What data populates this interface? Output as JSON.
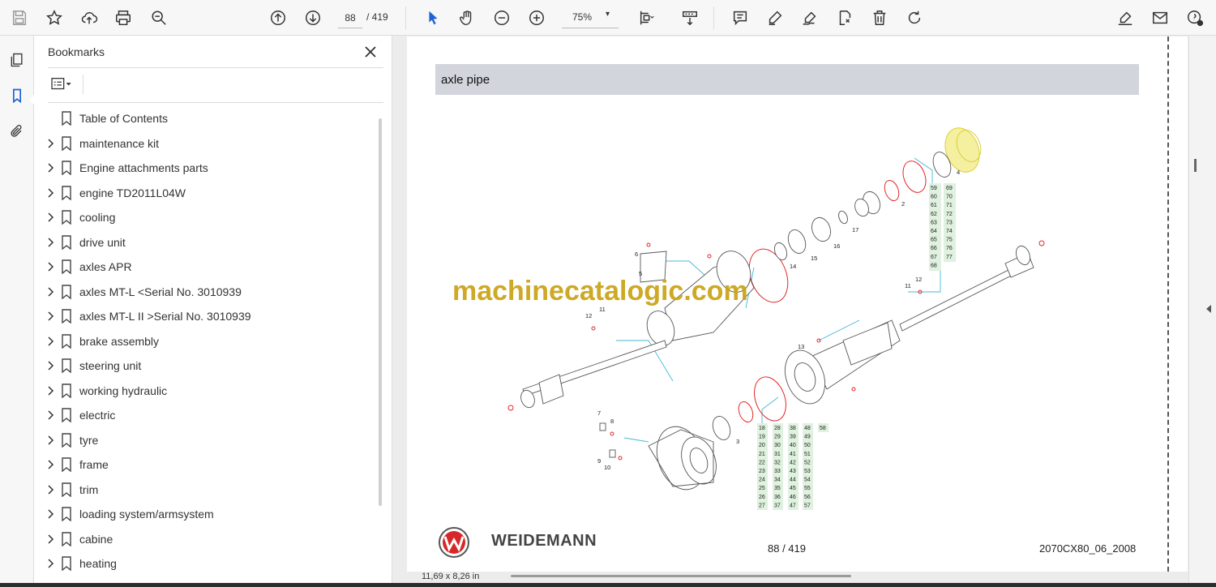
{
  "toolbar": {
    "page_current": "88",
    "page_total": "/ 419",
    "zoom": "75%",
    "icons": [
      "save-icon",
      "star-icon",
      "upload-cloud-icon",
      "print-icon",
      "zoom-search-icon",
      "page-up-icon",
      "page-down-icon",
      "select-cursor-icon",
      "hand-pan-icon",
      "zoom-out-icon",
      "zoom-in-icon",
      "fit-page-icon",
      "scroll-mode-icon",
      "comment-icon",
      "highlight-pen-icon",
      "draw-icon",
      "stamp-icon",
      "delete-icon",
      "rotate-icon",
      "sign-icon",
      "mail-icon",
      "account-icon"
    ]
  },
  "panel": {
    "title": "Bookmarks",
    "bookmarks": [
      {
        "label": "Table of Contents",
        "expandable": false
      },
      {
        "label": "maintenance kit",
        "expandable": true
      },
      {
        "label": "Engine attachments parts",
        "expandable": true
      },
      {
        "label": "engine TD2011L04W",
        "expandable": true
      },
      {
        "label": "cooling",
        "expandable": true
      },
      {
        "label": "drive unit",
        "expandable": true
      },
      {
        "label": "axles APR",
        "expandable": true
      },
      {
        "label": "axles MT-L <Serial No. 3010939",
        "expandable": true
      },
      {
        "label": "axles MT-L II >Serial No. 3010939",
        "expandable": true
      },
      {
        "label": "brake assembly",
        "expandable": true
      },
      {
        "label": "steering unit",
        "expandable": true
      },
      {
        "label": "working hydraulic",
        "expandable": true
      },
      {
        "label": "electric",
        "expandable": true
      },
      {
        "label": "tyre",
        "expandable": true
      },
      {
        "label": "frame",
        "expandable": true
      },
      {
        "label": "trim",
        "expandable": true
      },
      {
        "label": "loading system/armsystem",
        "expandable": true
      },
      {
        "label": "cabine",
        "expandable": true
      },
      {
        "label": "heating",
        "expandable": true
      }
    ]
  },
  "document": {
    "section_title": "axle pipe",
    "watermark": "machinecatalogic.com",
    "brand": "WEIDEMANN",
    "page_footer": "88 / 419",
    "doc_code": "2070CX80_06_2008",
    "page_size": "11,69 x 8,26 in",
    "callouts": [
      "2",
      "3",
      "4",
      "5",
      "6",
      "7",
      "8",
      "9",
      "10",
      "11",
      "12",
      "13",
      "14",
      "15",
      "16",
      "17"
    ],
    "table_top": {
      "col1": [
        "59",
        "60",
        "61",
        "62",
        "63",
        "64",
        "65",
        "66",
        "67",
        "68"
      ],
      "col2": [
        "69",
        "70",
        "71",
        "72",
        "73",
        "74",
        "75",
        "76",
        "77"
      ]
    },
    "table_bottom": {
      "col1": [
        "18",
        "19",
        "20",
        "21",
        "22",
        "23",
        "24",
        "25",
        "26",
        "27"
      ],
      "col2": [
        "28",
        "29",
        "30",
        "31",
        "32",
        "33",
        "34",
        "35",
        "36",
        "37"
      ],
      "col3": [
        "38",
        "39",
        "40",
        "41",
        "42",
        "43",
        "44",
        "45",
        "46",
        "47"
      ],
      "col4": [
        "48",
        "49",
        "50",
        "51",
        "52",
        "53",
        "54",
        "55",
        "56",
        "57"
      ],
      "col5": [
        "58"
      ]
    },
    "colors": {
      "table_fill": "#dff1df",
      "leader": "#45b8d8",
      "seal": "#e02828",
      "gear": "#e8e04a"
    }
  }
}
